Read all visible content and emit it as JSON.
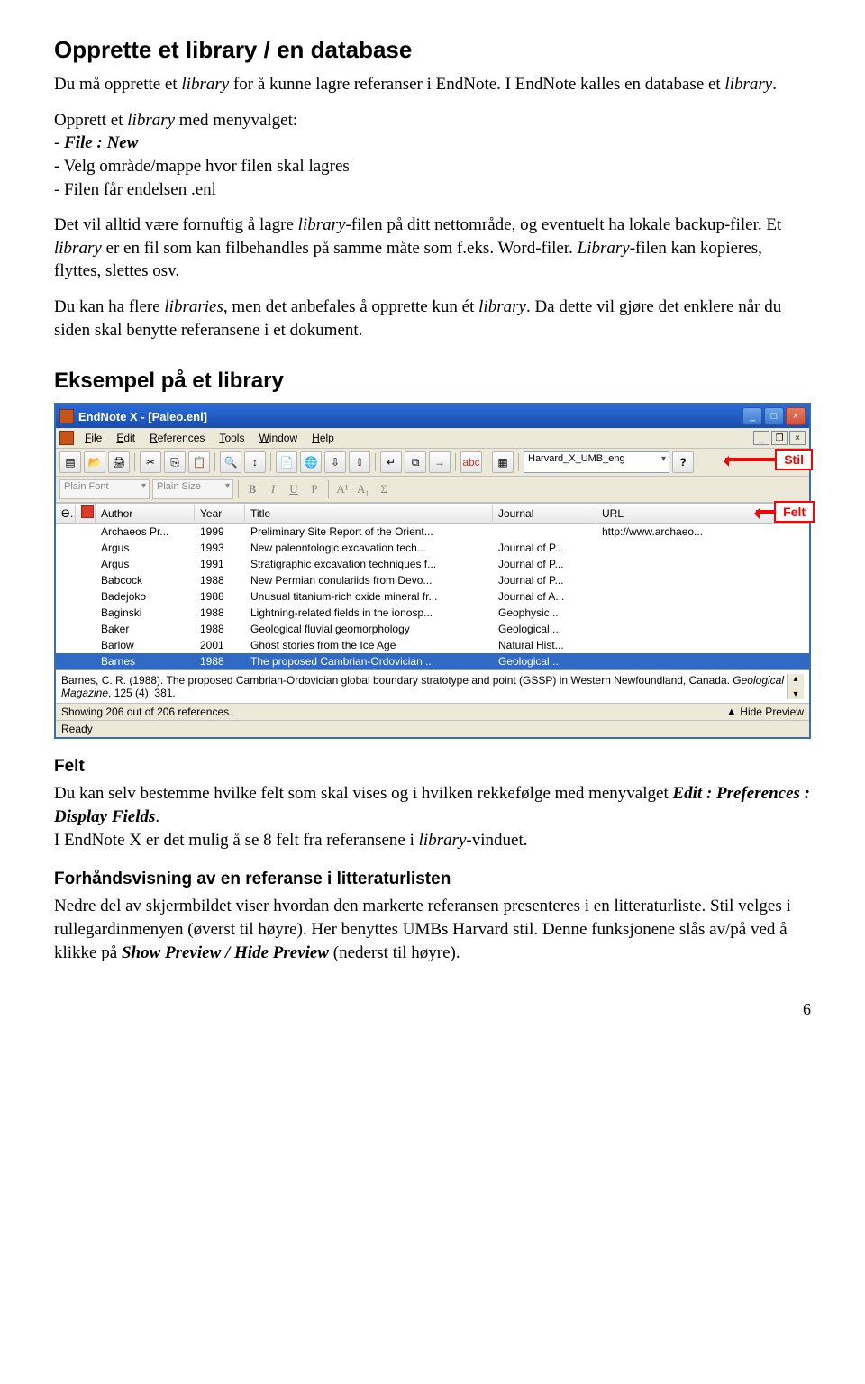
{
  "h1": "Opprette et library / en database",
  "p1_a": "Du må opprette et ",
  "p1_b": "library",
  "p1_c": " for å kunne lagre referanser i EndNote. I EndNote kalles en database et ",
  "p1_d": "library",
  "p1_e": ".",
  "p2_a": "Opprett et ",
  "p2_b": "library",
  "p2_c": " med menyvalget:",
  "li1_a": "- ",
  "li1_b": "File : New",
  "li2": "- Velg område/mappe hvor filen skal lagres",
  "li3": "- Filen får endelsen .enl",
  "p3_a": "Det vil alltid være fornuftig å lagre ",
  "p3_b": "library",
  "p3_c": "-filen på ditt nettområde, og eventuelt ha lokale backup-filer. Et ",
  "p3_d": "library",
  "p3_e": " er en fil som kan filbehandles på samme måte som f.eks. Word-filer. ",
  "p3_f": "Library",
  "p3_g": "-filen kan kopieres, flyttes, slettes osv.",
  "p4_a": "Du kan ha flere ",
  "p4_b": "libraries",
  "p4_c": ", men det anbefales å opprette kun ét ",
  "p4_d": "library",
  "p4_e": ". Da dette vil gjøre det enklere når du siden skal benytte referansene i et dokument.",
  "h2": "Eksempel på et library",
  "callout_stil": "Stil",
  "callout_felt": "Felt",
  "app": {
    "title": "EndNote X - [Paleo.enl]",
    "menu": {
      "file": "File",
      "edit": "Edit",
      "references": "References",
      "tools": "Tools",
      "window": "Window",
      "help": "Help"
    },
    "style_selected": "Harvard_X_UMB_eng",
    "q": "?",
    "font": "Plain Font",
    "size": "Plain Size",
    "fmt": {
      "b": "B",
      "i": "I",
      "u": "U",
      "p": "P",
      "a1": "A¹",
      "a1b": "A₁",
      "sigma": "Σ"
    },
    "headers": {
      "c0": "ϴ",
      "c2": "Author",
      "c3": "Year",
      "c4": "Title",
      "c5": "Journal",
      "c6": "URL"
    },
    "rows": [
      {
        "author": "Archaeos Pr...",
        "year": "1999",
        "title": "Preliminary Site Report of the Orient...",
        "journal": "",
        "url": "http://www.archaeo..."
      },
      {
        "author": "Argus",
        "year": "1993",
        "title": "New paleontologic excavation tech...",
        "journal": "Journal of P...",
        "url": ""
      },
      {
        "author": "Argus",
        "year": "1991",
        "title": "Stratigraphic excavation techniques f...",
        "journal": "Journal of P...",
        "url": ""
      },
      {
        "author": "Babcock",
        "year": "1988",
        "title": "New Permian conulariids from Devo...",
        "journal": "Journal of P...",
        "url": ""
      },
      {
        "author": "Badejoko",
        "year": "1988",
        "title": "Unusual titanium-rich oxide mineral fr...",
        "journal": "Journal of A...",
        "url": ""
      },
      {
        "author": "Baginski",
        "year": "1988",
        "title": "Lightning-related fields in the ionosp...",
        "journal": "Geophysic...",
        "url": ""
      },
      {
        "author": "Baker",
        "year": "1988",
        "title": "Geological fluvial geomorphology",
        "journal": "Geological ...",
        "url": ""
      },
      {
        "author": "Barlow",
        "year": "2001",
        "title": "Ghost stories from the Ice Age",
        "journal": "Natural Hist...",
        "url": ""
      },
      {
        "author": "Barnes",
        "year": "1988",
        "title": "The proposed Cambrian-Ordovician ...",
        "journal": "Geological ...",
        "url": ""
      }
    ],
    "preview": "Barnes, C. R. (1988). The proposed Cambrian-Ordovician global boundary stratotype and point (GSSP) in Western Newfoundland, Canada. Geological Magazine, 125 (4): 381.",
    "status": "Showing 206 out of 206 references.",
    "hide_preview": "Hide Preview",
    "ready": "Ready"
  },
  "felt_h": "Felt",
  "felt_p_a": "Du kan selv bestemme hvilke felt som skal vises og i hvilken rekkefølge med menyvalget ",
  "felt_p_b": "Edit : Preferences : Display Fields",
  "felt_p_c": ".",
  "felt_p2_a": "I EndNote X er det mulig å se 8 felt fra referansene i ",
  "felt_p2_b": "library",
  "felt_p2_c": "-vinduet.",
  "forh_h": "Forhåndsvisning av en referanse i litteraturlisten",
  "forh_p_a": "Nedre del av skjermbildet viser hvordan den markerte referansen presenteres i en litteraturliste. Stil velges i rullegardinmenyen (øverst til høyre). Her benyttes UMBs Harvard stil. Denne funksjonene slås av/på ved å klikke på ",
  "forh_p_b": "Show Preview / Hide Preview",
  "forh_p_c": " (nederst til høyre).",
  "page": "6"
}
